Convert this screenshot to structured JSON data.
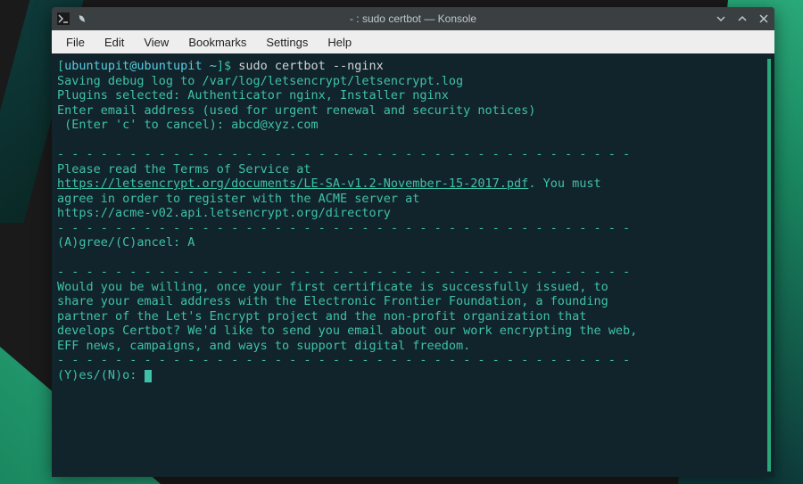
{
  "window": {
    "title": "- : sudo certbot — Konsole"
  },
  "menu": {
    "file": "File",
    "edit": "Edit",
    "view": "View",
    "bookmarks": "Bookmarks",
    "settings": "Settings",
    "help": "Help"
  },
  "terminal": {
    "prompt_open": "[",
    "prompt_user": "ubuntupit@ubuntupit ~",
    "prompt_close": "]$ ",
    "command": "sudo certbot --nginx",
    "line_saving": "Saving debug log to /var/log/letsencrypt/letsencrypt.log",
    "line_plugins": "Plugins selected: Authenticator nginx, Installer nginx",
    "line_enter_email": "Enter email address (used for urgent renewal and security notices)",
    "line_enter_c": " (Enter 'c' to cancel): abcd@xyz.com",
    "dashes": "- - - - - - - - - - - - - - - - - - - - - - - - - - - - - - - - - - - - - - - -",
    "line_please_read": "Please read the Terms of Service at",
    "tos_link": "https://letsencrypt.org/documents/LE-SA-v1.2-November-15-2017.pdf",
    "tos_after": ". You must",
    "line_agree": "agree in order to register with the ACME server at",
    "line_acme": "https://acme-v02.api.letsencrypt.org/directory",
    "line_agree_cancel": "(A)gree/(C)ancel: A",
    "line_eff_1": "Would you be willing, once your first certificate is successfully issued, to",
    "line_eff_2": "share your email address with the Electronic Frontier Foundation, a founding",
    "line_eff_3": "partner of the Let's Encrypt project and the non-profit organization that",
    "line_eff_4": "develops Certbot? We'd like to send you email about our work encrypting the web,",
    "line_eff_5": "EFF news, campaigns, and ways to support digital freedom.",
    "line_yesno": "(Y)es/(N)o: "
  }
}
